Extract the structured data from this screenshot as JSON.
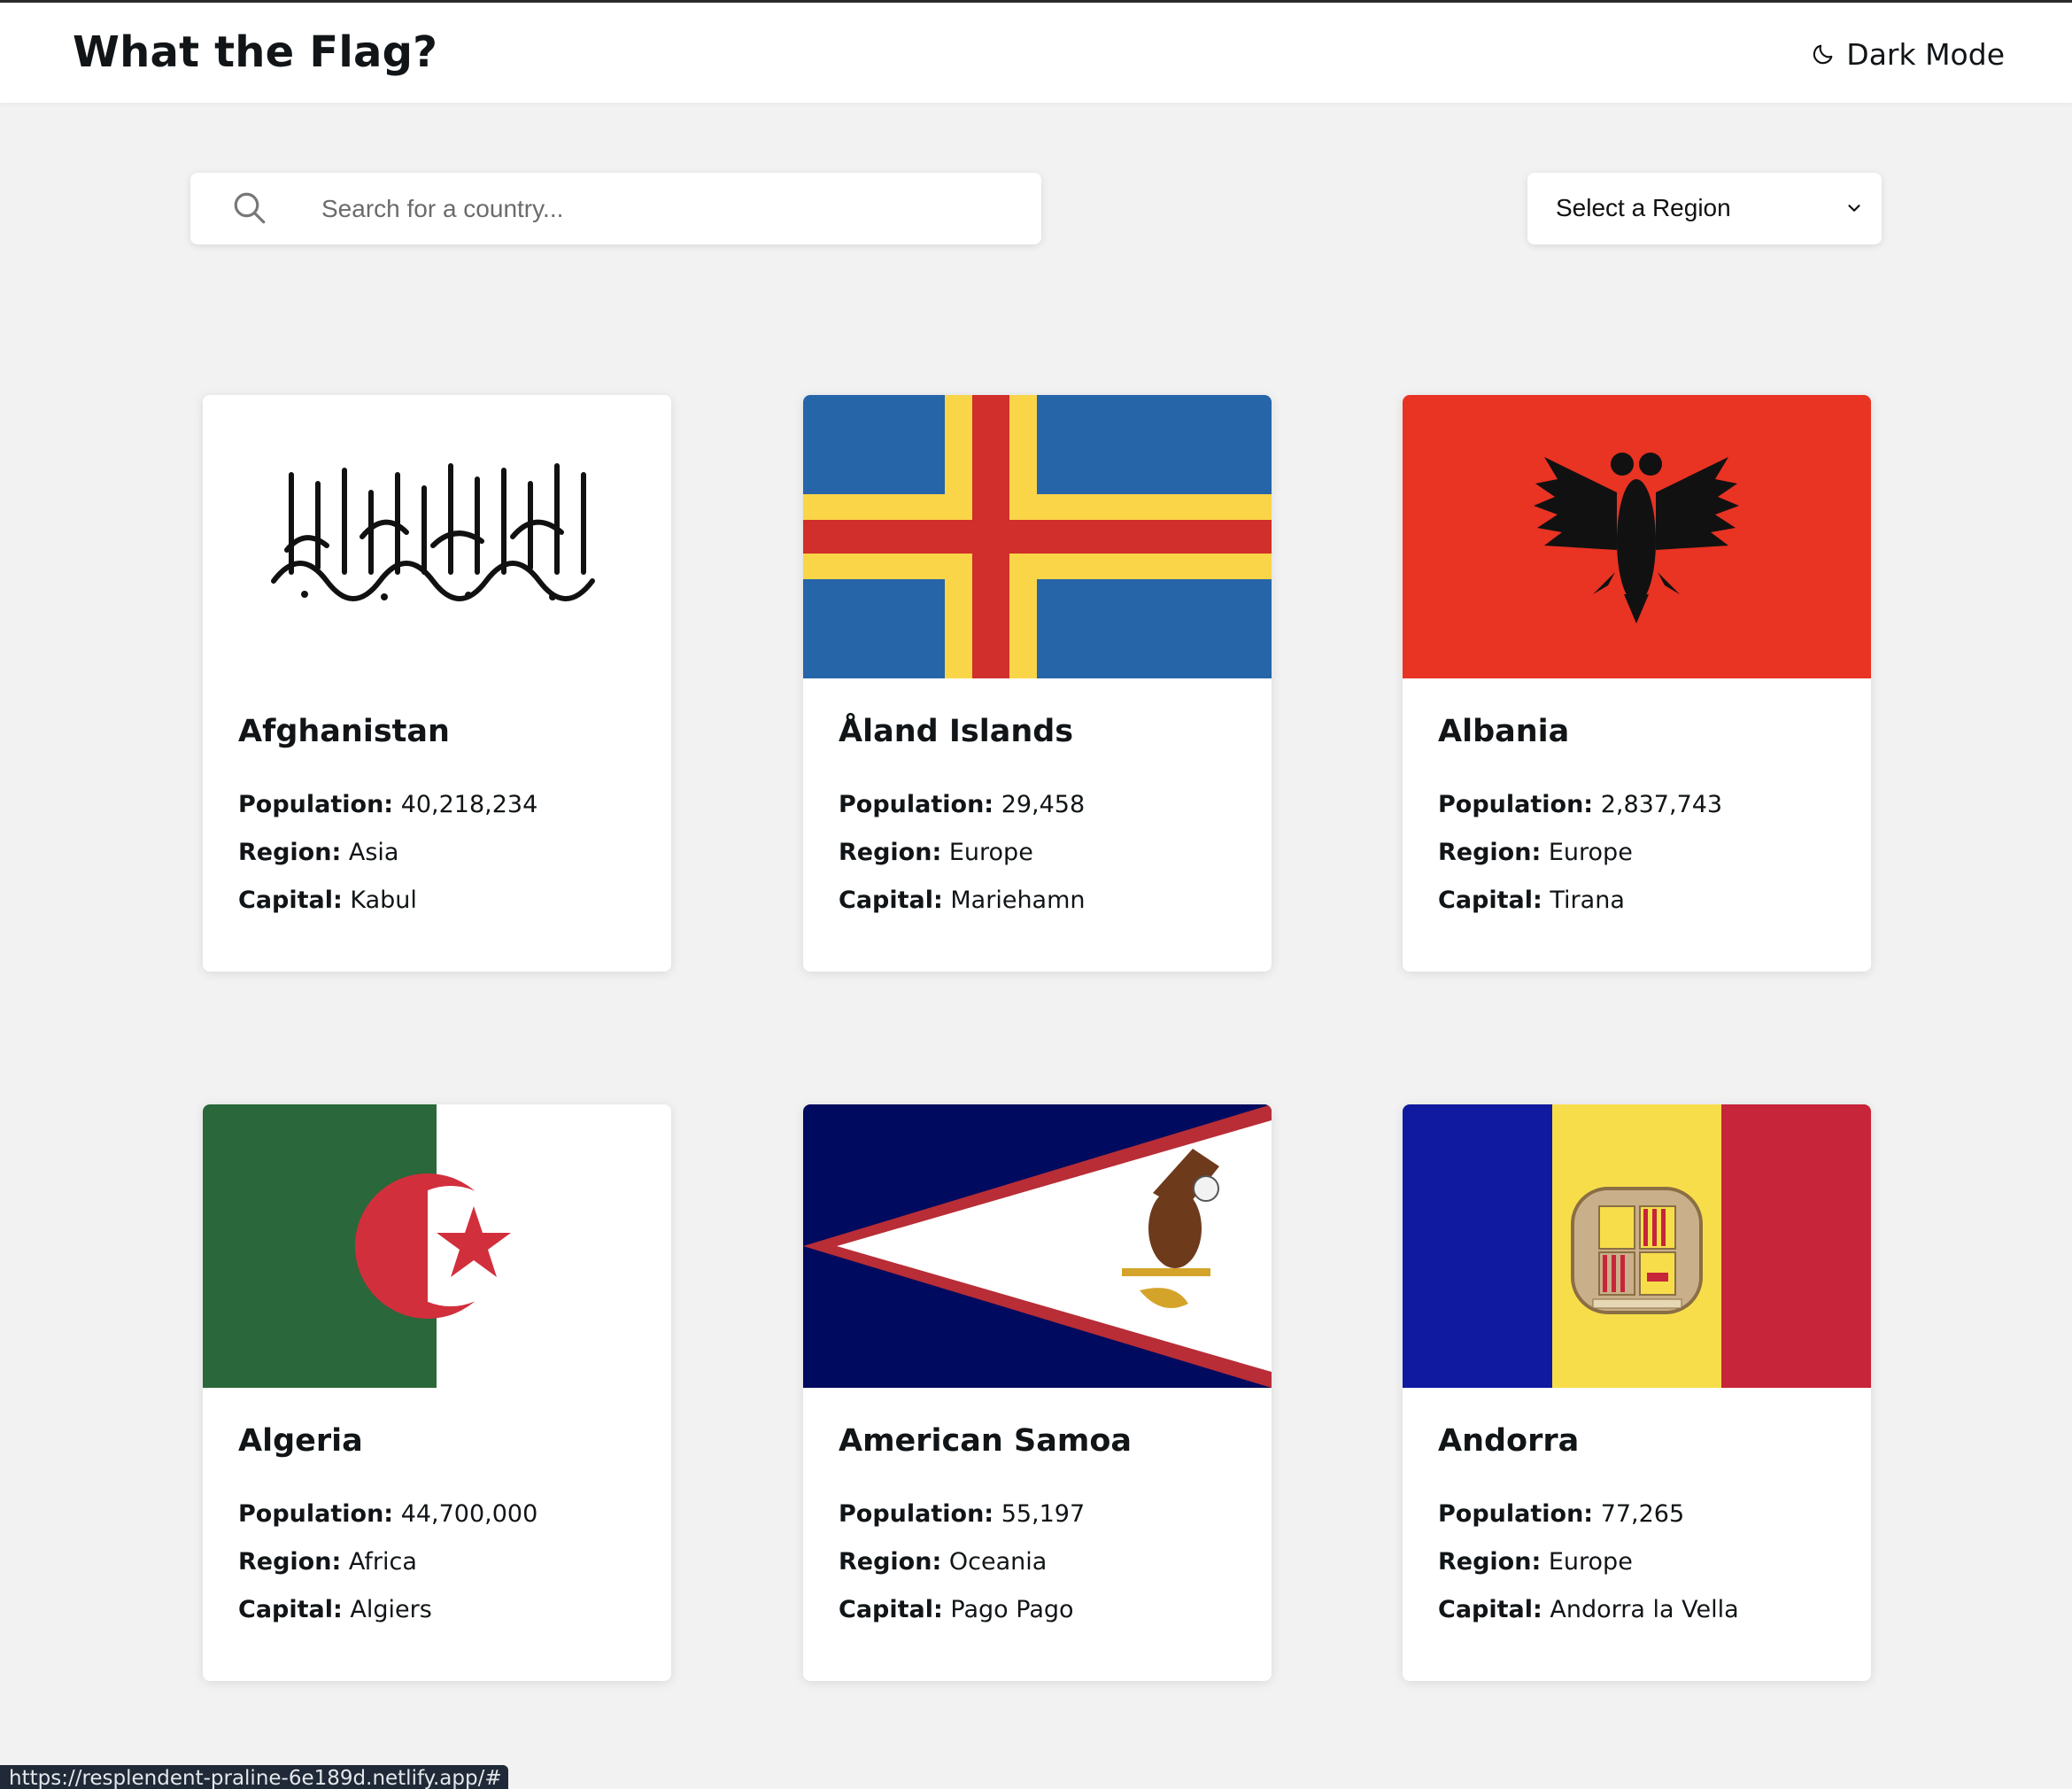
{
  "header": {
    "title": "What the Flag?",
    "dark_mode_label": "Dark Mode",
    "dark_mode_icon": "moon-icon"
  },
  "search": {
    "placeholder": "Search for a country...",
    "value": "",
    "icon": "search-icon"
  },
  "region_filter": {
    "selected": "Select a Region",
    "icon": "chevron-down-icon"
  },
  "labels": {
    "population": "Population:",
    "region": "Region:",
    "capital": "Capital:"
  },
  "countries": [
    {
      "name": "Afghanistan",
      "population": "40,218,234",
      "region": "Asia",
      "capital": "Kabul",
      "flag": "afghanistan-flag"
    },
    {
      "name": "Åland Islands",
      "population": "29,458",
      "region": "Europe",
      "capital": "Mariehamn",
      "flag": "aland-flag"
    },
    {
      "name": "Albania",
      "population": "2,837,743",
      "region": "Europe",
      "capital": "Tirana",
      "flag": "albania-flag"
    },
    {
      "name": "Algeria",
      "population": "44,700,000",
      "region": "Africa",
      "capital": "Algiers",
      "flag": "algeria-flag"
    },
    {
      "name": "American Samoa",
      "population": "55,197",
      "region": "Oceania",
      "capital": "Pago Pago",
      "flag": "american-samoa-flag"
    },
    {
      "name": "Andorra",
      "population": "77,265",
      "region": "Europe",
      "capital": "Andorra la Vella",
      "flag": "andorra-flag"
    }
  ],
  "status_bar": {
    "url": "https://resplendent-praline-6e189d.netlify.app/#"
  },
  "colors": {
    "background": "#f2f2f2",
    "card": "#ffffff",
    "text": "#111517"
  }
}
